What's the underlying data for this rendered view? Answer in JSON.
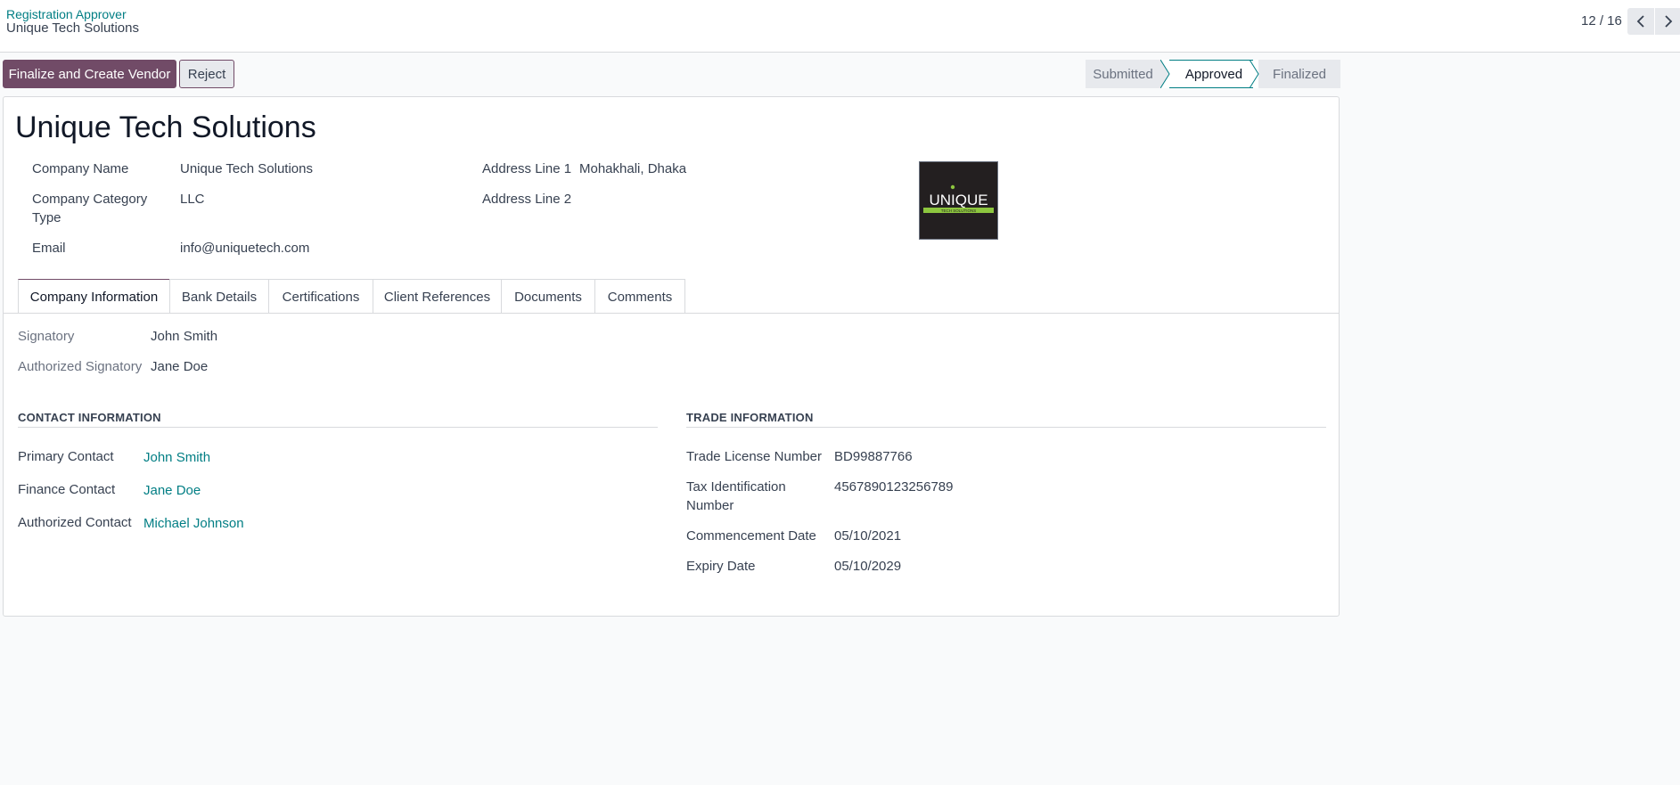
{
  "breadcrumb": {
    "parent": "Registration Approver",
    "current": "Unique Tech Solutions"
  },
  "pager": {
    "text": "12 / 16"
  },
  "actions": {
    "finalize_label": "Finalize and Create Vendor",
    "reject_label": "Reject"
  },
  "statusbar": {
    "stages": [
      "Submitted",
      "Approved",
      "Finalized"
    ],
    "active": "Approved"
  },
  "record": {
    "title": "Unique Tech Solutions",
    "fields": {
      "company_name": {
        "label": "Company Name",
        "value": "Unique Tech Solutions"
      },
      "company_category_type": {
        "label_line1": "Company Category",
        "label_line2": "Type",
        "value": "LLC"
      },
      "email": {
        "label": "Email",
        "value": "info@uniquetech.com"
      },
      "address_line_1": {
        "label": "Address Line 1",
        "value": "Mohakhali, Dhaka"
      },
      "address_line_2": {
        "label": "Address Line 2",
        "value": ""
      }
    },
    "logo": {
      "text": "UNIQUE",
      "subtext": "TECH SOLUTIONS",
      "accent": "#8dc63f"
    }
  },
  "tabs": [
    "Company Information",
    "Bank Details",
    "Certifications",
    "Client References",
    "Documents",
    "Comments"
  ],
  "company_info": {
    "signatory": {
      "label": "Signatory",
      "value": "John Smith"
    },
    "authorized_signatory": {
      "label": "Authorized Signatory",
      "value": "Jane Doe"
    },
    "contact_section": {
      "heading": "CONTACT INFORMATION",
      "primary_contact": {
        "label": "Primary Contact",
        "value": "John Smith"
      },
      "finance_contact": {
        "label": "Finance Contact",
        "value": "Jane Doe"
      },
      "authorized_contact": {
        "label": "Authorized Contact",
        "value": "Michael Johnson"
      }
    },
    "trade_section": {
      "heading": "TRADE INFORMATION",
      "trade_license_number": {
        "label": "Trade License Number",
        "value": "BD99887766"
      },
      "tax_identification_number": {
        "label_line1": "Tax Identification",
        "label_line2": "Number",
        "value": "4567890123256789"
      },
      "commencement_date": {
        "label": "Commencement Date",
        "value": "05/10/2021"
      },
      "expiry_date": {
        "label": "Expiry Date",
        "value": "05/10/2029"
      }
    }
  },
  "colors": {
    "brand": "#714b67",
    "link": "#017e84"
  }
}
